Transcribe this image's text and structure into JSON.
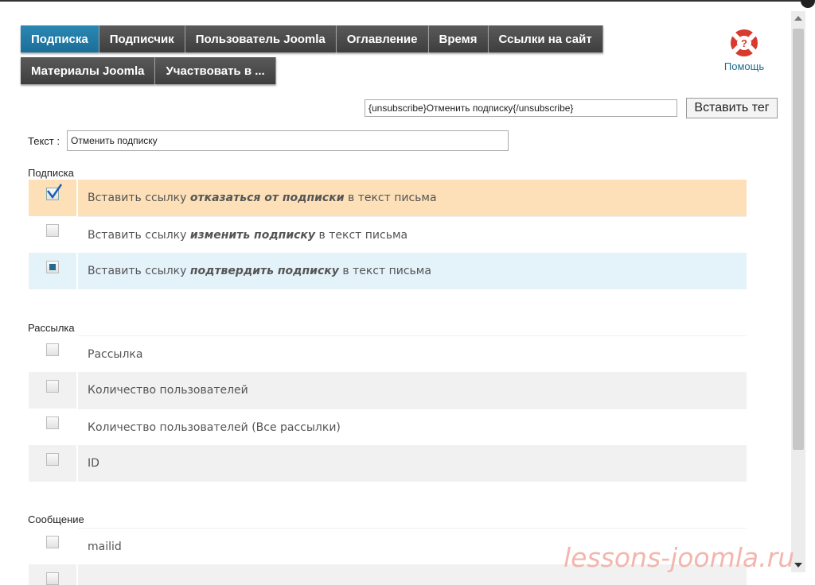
{
  "tabs": {
    "row1": [
      "Подписка",
      "Подписчик",
      "Пользователь Joomla",
      "Оглавление",
      "Время",
      "Ссылки на сайт"
    ],
    "row2": [
      "Материалы Joomla",
      "Участвовать в ..."
    ]
  },
  "help": {
    "label": "Помощь"
  },
  "tag": {
    "value": "{unsubscribe}Отменить подписку{/unsubscribe}",
    "insert_label": "Вставить тег"
  },
  "text_field": {
    "label": "Текст :",
    "value": "Отменить подписку"
  },
  "sections": {
    "subscription": {
      "title": "Подписка",
      "items": [
        {
          "prefix": "Вставить ссылку ",
          "emph": "отказаться от подписки",
          "suffix": " в текст письма"
        },
        {
          "prefix": "Вставить ссылку ",
          "emph": "изменить подписку",
          "suffix": " в текст письма"
        },
        {
          "prefix": "Вставить ссылку ",
          "emph": "подтвердить подписку",
          "suffix": " в текст письма"
        }
      ]
    },
    "mailing": {
      "title": "Рассылка",
      "items": [
        "Рассылка",
        "Количество пользователей",
        "Количество пользователей (Все рассылки)",
        "ID"
      ]
    },
    "message": {
      "title": "Сообщение",
      "items": [
        "mailid"
      ]
    }
  },
  "watermark": "lessons-joomla.ru",
  "colors": {
    "active_tab": "#1b6f98",
    "tab": "#444444",
    "highlight_row": "#fde0b8",
    "selected_row": "#e4f2fa",
    "help_text": "#1f6c8e"
  }
}
